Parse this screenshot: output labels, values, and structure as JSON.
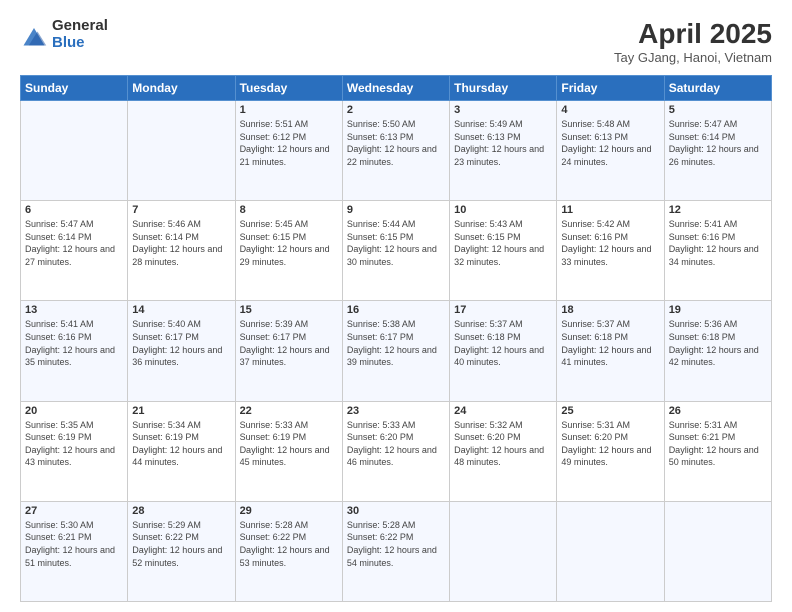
{
  "logo": {
    "general": "General",
    "blue": "Blue"
  },
  "title": {
    "main": "April 2025",
    "sub": "Tay GJang, Hanoi, Vietnam"
  },
  "days_header": [
    "Sunday",
    "Monday",
    "Tuesday",
    "Wednesday",
    "Thursday",
    "Friday",
    "Saturday"
  ],
  "weeks": [
    [
      {
        "day": "",
        "sunrise": "",
        "sunset": "",
        "daylight": ""
      },
      {
        "day": "",
        "sunrise": "",
        "sunset": "",
        "daylight": ""
      },
      {
        "day": "1",
        "sunrise": "Sunrise: 5:51 AM",
        "sunset": "Sunset: 6:12 PM",
        "daylight": "Daylight: 12 hours and 21 minutes."
      },
      {
        "day": "2",
        "sunrise": "Sunrise: 5:50 AM",
        "sunset": "Sunset: 6:13 PM",
        "daylight": "Daylight: 12 hours and 22 minutes."
      },
      {
        "day": "3",
        "sunrise": "Sunrise: 5:49 AM",
        "sunset": "Sunset: 6:13 PM",
        "daylight": "Daylight: 12 hours and 23 minutes."
      },
      {
        "day": "4",
        "sunrise": "Sunrise: 5:48 AM",
        "sunset": "Sunset: 6:13 PM",
        "daylight": "Daylight: 12 hours and 24 minutes."
      },
      {
        "day": "5",
        "sunrise": "Sunrise: 5:47 AM",
        "sunset": "Sunset: 6:14 PM",
        "daylight": "Daylight: 12 hours and 26 minutes."
      }
    ],
    [
      {
        "day": "6",
        "sunrise": "Sunrise: 5:47 AM",
        "sunset": "Sunset: 6:14 PM",
        "daylight": "Daylight: 12 hours and 27 minutes."
      },
      {
        "day": "7",
        "sunrise": "Sunrise: 5:46 AM",
        "sunset": "Sunset: 6:14 PM",
        "daylight": "Daylight: 12 hours and 28 minutes."
      },
      {
        "day": "8",
        "sunrise": "Sunrise: 5:45 AM",
        "sunset": "Sunset: 6:15 PM",
        "daylight": "Daylight: 12 hours and 29 minutes."
      },
      {
        "day": "9",
        "sunrise": "Sunrise: 5:44 AM",
        "sunset": "Sunset: 6:15 PM",
        "daylight": "Daylight: 12 hours and 30 minutes."
      },
      {
        "day": "10",
        "sunrise": "Sunrise: 5:43 AM",
        "sunset": "Sunset: 6:15 PM",
        "daylight": "Daylight: 12 hours and 32 minutes."
      },
      {
        "day": "11",
        "sunrise": "Sunrise: 5:42 AM",
        "sunset": "Sunset: 6:16 PM",
        "daylight": "Daylight: 12 hours and 33 minutes."
      },
      {
        "day": "12",
        "sunrise": "Sunrise: 5:41 AM",
        "sunset": "Sunset: 6:16 PM",
        "daylight": "Daylight: 12 hours and 34 minutes."
      }
    ],
    [
      {
        "day": "13",
        "sunrise": "Sunrise: 5:41 AM",
        "sunset": "Sunset: 6:16 PM",
        "daylight": "Daylight: 12 hours and 35 minutes."
      },
      {
        "day": "14",
        "sunrise": "Sunrise: 5:40 AM",
        "sunset": "Sunset: 6:17 PM",
        "daylight": "Daylight: 12 hours and 36 minutes."
      },
      {
        "day": "15",
        "sunrise": "Sunrise: 5:39 AM",
        "sunset": "Sunset: 6:17 PM",
        "daylight": "Daylight: 12 hours and 37 minutes."
      },
      {
        "day": "16",
        "sunrise": "Sunrise: 5:38 AM",
        "sunset": "Sunset: 6:17 PM",
        "daylight": "Daylight: 12 hours and 39 minutes."
      },
      {
        "day": "17",
        "sunrise": "Sunrise: 5:37 AM",
        "sunset": "Sunset: 6:18 PM",
        "daylight": "Daylight: 12 hours and 40 minutes."
      },
      {
        "day": "18",
        "sunrise": "Sunrise: 5:37 AM",
        "sunset": "Sunset: 6:18 PM",
        "daylight": "Daylight: 12 hours and 41 minutes."
      },
      {
        "day": "19",
        "sunrise": "Sunrise: 5:36 AM",
        "sunset": "Sunset: 6:18 PM",
        "daylight": "Daylight: 12 hours and 42 minutes."
      }
    ],
    [
      {
        "day": "20",
        "sunrise": "Sunrise: 5:35 AM",
        "sunset": "Sunset: 6:19 PM",
        "daylight": "Daylight: 12 hours and 43 minutes."
      },
      {
        "day": "21",
        "sunrise": "Sunrise: 5:34 AM",
        "sunset": "Sunset: 6:19 PM",
        "daylight": "Daylight: 12 hours and 44 minutes."
      },
      {
        "day": "22",
        "sunrise": "Sunrise: 5:33 AM",
        "sunset": "Sunset: 6:19 PM",
        "daylight": "Daylight: 12 hours and 45 minutes."
      },
      {
        "day": "23",
        "sunrise": "Sunrise: 5:33 AM",
        "sunset": "Sunset: 6:20 PM",
        "daylight": "Daylight: 12 hours and 46 minutes."
      },
      {
        "day": "24",
        "sunrise": "Sunrise: 5:32 AM",
        "sunset": "Sunset: 6:20 PM",
        "daylight": "Daylight: 12 hours and 48 minutes."
      },
      {
        "day": "25",
        "sunrise": "Sunrise: 5:31 AM",
        "sunset": "Sunset: 6:20 PM",
        "daylight": "Daylight: 12 hours and 49 minutes."
      },
      {
        "day": "26",
        "sunrise": "Sunrise: 5:31 AM",
        "sunset": "Sunset: 6:21 PM",
        "daylight": "Daylight: 12 hours and 50 minutes."
      }
    ],
    [
      {
        "day": "27",
        "sunrise": "Sunrise: 5:30 AM",
        "sunset": "Sunset: 6:21 PM",
        "daylight": "Daylight: 12 hours and 51 minutes."
      },
      {
        "day": "28",
        "sunrise": "Sunrise: 5:29 AM",
        "sunset": "Sunset: 6:22 PM",
        "daylight": "Daylight: 12 hours and 52 minutes."
      },
      {
        "day": "29",
        "sunrise": "Sunrise: 5:28 AM",
        "sunset": "Sunset: 6:22 PM",
        "daylight": "Daylight: 12 hours and 53 minutes."
      },
      {
        "day": "30",
        "sunrise": "Sunrise: 5:28 AM",
        "sunset": "Sunset: 6:22 PM",
        "daylight": "Daylight: 12 hours and 54 minutes."
      },
      {
        "day": "",
        "sunrise": "",
        "sunset": "",
        "daylight": ""
      },
      {
        "day": "",
        "sunrise": "",
        "sunset": "",
        "daylight": ""
      },
      {
        "day": "",
        "sunrise": "",
        "sunset": "",
        "daylight": ""
      }
    ]
  ]
}
